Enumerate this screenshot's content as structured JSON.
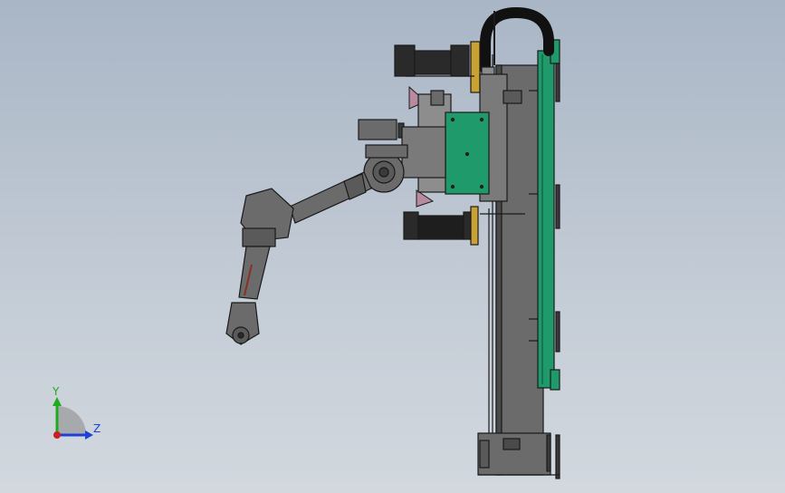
{
  "triad": {
    "y_label": "Y",
    "z_label": "Z",
    "y_color": "#1faa1f",
    "z_color": "#1f3fd8",
    "origin_color": "#cc1f1f"
  },
  "colors": {
    "gray_body": "#6b6b6b",
    "dark_body": "#3a3a3a",
    "green_plate": "#1f9a6a",
    "gold_plate": "#c9a233",
    "pink_bracket": "#b78aa0",
    "outline": "#1a1a1a"
  }
}
